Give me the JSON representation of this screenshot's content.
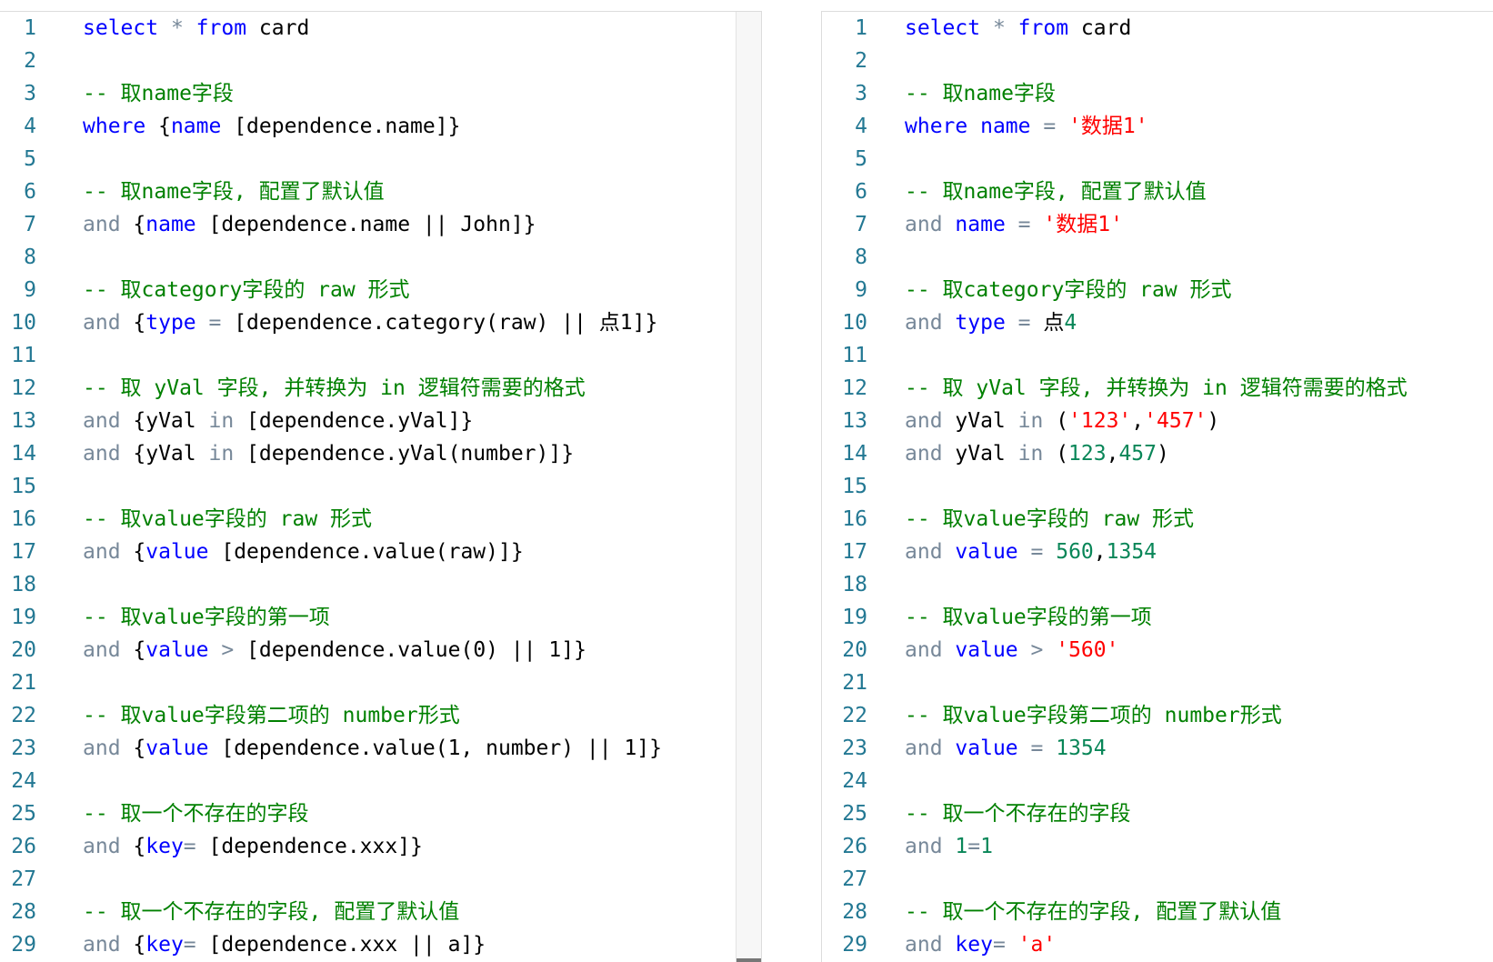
{
  "left_editor": {
    "lines": [
      {
        "no": "1",
        "tokens": [
          {
            "t": "kw",
            "v": "select"
          },
          {
            "t": "txt",
            "v": " "
          },
          {
            "t": "op",
            "v": "*"
          },
          {
            "t": "txt",
            "v": " "
          },
          {
            "t": "kw",
            "v": "from"
          },
          {
            "t": "txt",
            "v": " card"
          }
        ]
      },
      {
        "no": "2",
        "tokens": []
      },
      {
        "no": "3",
        "tokens": [
          {
            "t": "cmt",
            "v": "-- 取name字段"
          }
        ]
      },
      {
        "no": "4",
        "tokens": [
          {
            "t": "kw",
            "v": "where"
          },
          {
            "t": "txt",
            "v": " {"
          },
          {
            "t": "kw",
            "v": "name"
          },
          {
            "t": "txt",
            "v": " [dependence.name]}"
          }
        ]
      },
      {
        "no": "5",
        "tokens": []
      },
      {
        "no": "6",
        "tokens": [
          {
            "t": "cmt",
            "v": "-- 取name字段, 配置了默认值"
          }
        ]
      },
      {
        "no": "7",
        "tokens": [
          {
            "t": "op",
            "v": "and"
          },
          {
            "t": "txt",
            "v": " {"
          },
          {
            "t": "kw",
            "v": "name"
          },
          {
            "t": "txt",
            "v": " [dependence.name || John]}"
          }
        ]
      },
      {
        "no": "8",
        "tokens": []
      },
      {
        "no": "9",
        "tokens": [
          {
            "t": "cmt",
            "v": "-- 取category字段的 raw 形式"
          }
        ]
      },
      {
        "no": "10",
        "tokens": [
          {
            "t": "op",
            "v": "and"
          },
          {
            "t": "txt",
            "v": " {"
          },
          {
            "t": "kw",
            "v": "type"
          },
          {
            "t": "txt",
            "v": " "
          },
          {
            "t": "op",
            "v": "="
          },
          {
            "t": "txt",
            "v": " [dependence.category(raw) || 点1]}"
          }
        ]
      },
      {
        "no": "11",
        "tokens": []
      },
      {
        "no": "12",
        "tokens": [
          {
            "t": "cmt",
            "v": "-- 取 yVal 字段, 并转换为 in 逻辑符需要的格式"
          }
        ]
      },
      {
        "no": "13",
        "tokens": [
          {
            "t": "op",
            "v": "and"
          },
          {
            "t": "txt",
            "v": " {yVal "
          },
          {
            "t": "op",
            "v": "in"
          },
          {
            "t": "txt",
            "v": " [dependence.yVal]}"
          }
        ]
      },
      {
        "no": "14",
        "tokens": [
          {
            "t": "op",
            "v": "and"
          },
          {
            "t": "txt",
            "v": " {yVal "
          },
          {
            "t": "op",
            "v": "in"
          },
          {
            "t": "txt",
            "v": " [dependence.yVal(number)]}"
          }
        ]
      },
      {
        "no": "15",
        "tokens": []
      },
      {
        "no": "16",
        "tokens": [
          {
            "t": "cmt",
            "v": "-- 取value字段的 raw 形式"
          }
        ]
      },
      {
        "no": "17",
        "tokens": [
          {
            "t": "op",
            "v": "and"
          },
          {
            "t": "txt",
            "v": " {"
          },
          {
            "t": "kw",
            "v": "value"
          },
          {
            "t": "txt",
            "v": " [dependence.value(raw)]}"
          }
        ]
      },
      {
        "no": "18",
        "tokens": []
      },
      {
        "no": "19",
        "tokens": [
          {
            "t": "cmt",
            "v": "-- 取value字段的第一项"
          }
        ]
      },
      {
        "no": "20",
        "tokens": [
          {
            "t": "op",
            "v": "and"
          },
          {
            "t": "txt",
            "v": " {"
          },
          {
            "t": "kw",
            "v": "value"
          },
          {
            "t": "txt",
            "v": " "
          },
          {
            "t": "op",
            "v": ">"
          },
          {
            "t": "txt",
            "v": " [dependence.value(0) || 1]}"
          }
        ]
      },
      {
        "no": "21",
        "tokens": []
      },
      {
        "no": "22",
        "tokens": [
          {
            "t": "cmt",
            "v": "-- 取value字段第二项的 number形式"
          }
        ]
      },
      {
        "no": "23",
        "tokens": [
          {
            "t": "op",
            "v": "and"
          },
          {
            "t": "txt",
            "v": " {"
          },
          {
            "t": "kw",
            "v": "value"
          },
          {
            "t": "txt",
            "v": " [dependence.value(1, number) || 1]}"
          }
        ]
      },
      {
        "no": "24",
        "tokens": []
      },
      {
        "no": "25",
        "tokens": [
          {
            "t": "cmt",
            "v": "-- 取一个不存在的字段"
          }
        ]
      },
      {
        "no": "26",
        "tokens": [
          {
            "t": "op",
            "v": "and"
          },
          {
            "t": "txt",
            "v": " {"
          },
          {
            "t": "kw",
            "v": "key"
          },
          {
            "t": "op",
            "v": "="
          },
          {
            "t": "txt",
            "v": " [dependence.xxx]}"
          }
        ]
      },
      {
        "no": "27",
        "tokens": []
      },
      {
        "no": "28",
        "tokens": [
          {
            "t": "cmt",
            "v": "-- 取一个不存在的字段, 配置了默认值"
          }
        ]
      },
      {
        "no": "29",
        "tokens": [
          {
            "t": "op",
            "v": "and"
          },
          {
            "t": "txt",
            "v": " {"
          },
          {
            "t": "kw",
            "v": "key"
          },
          {
            "t": "op",
            "v": "="
          },
          {
            "t": "txt",
            "v": " [dependence.xxx || a]}"
          }
        ]
      }
    ]
  },
  "right_editor": {
    "lines": [
      {
        "no": "1",
        "tokens": [
          {
            "t": "kw",
            "v": "select"
          },
          {
            "t": "txt",
            "v": " "
          },
          {
            "t": "op",
            "v": "*"
          },
          {
            "t": "txt",
            "v": " "
          },
          {
            "t": "kw",
            "v": "from"
          },
          {
            "t": "txt",
            "v": " card"
          }
        ]
      },
      {
        "no": "2",
        "tokens": []
      },
      {
        "no": "3",
        "tokens": [
          {
            "t": "cmt",
            "v": "-- 取name字段"
          }
        ]
      },
      {
        "no": "4",
        "tokens": [
          {
            "t": "kw",
            "v": "where"
          },
          {
            "t": "txt",
            "v": " "
          },
          {
            "t": "kw",
            "v": "name"
          },
          {
            "t": "txt",
            "v": " "
          },
          {
            "t": "op",
            "v": "="
          },
          {
            "t": "txt",
            "v": " "
          },
          {
            "t": "str",
            "v": "'数据1'"
          }
        ]
      },
      {
        "no": "5",
        "tokens": []
      },
      {
        "no": "6",
        "tokens": [
          {
            "t": "cmt",
            "v": "-- 取name字段, 配置了默认值"
          }
        ]
      },
      {
        "no": "7",
        "tokens": [
          {
            "t": "op",
            "v": "and"
          },
          {
            "t": "txt",
            "v": " "
          },
          {
            "t": "kw",
            "v": "name"
          },
          {
            "t": "txt",
            "v": " "
          },
          {
            "t": "op",
            "v": "="
          },
          {
            "t": "txt",
            "v": " "
          },
          {
            "t": "str",
            "v": "'数据1'"
          }
        ]
      },
      {
        "no": "8",
        "tokens": []
      },
      {
        "no": "9",
        "tokens": [
          {
            "t": "cmt",
            "v": "-- 取category字段的 raw 形式"
          }
        ]
      },
      {
        "no": "10",
        "tokens": [
          {
            "t": "op",
            "v": "and"
          },
          {
            "t": "txt",
            "v": " "
          },
          {
            "t": "kw",
            "v": "type"
          },
          {
            "t": "txt",
            "v": " "
          },
          {
            "t": "op",
            "v": "="
          },
          {
            "t": "txt",
            "v": " 点"
          },
          {
            "t": "num",
            "v": "4"
          }
        ]
      },
      {
        "no": "11",
        "tokens": []
      },
      {
        "no": "12",
        "tokens": [
          {
            "t": "cmt",
            "v": "-- 取 yVal 字段, 并转换为 in 逻辑符需要的格式"
          }
        ]
      },
      {
        "no": "13",
        "tokens": [
          {
            "t": "op",
            "v": "and"
          },
          {
            "t": "txt",
            "v": " yVal "
          },
          {
            "t": "op",
            "v": "in"
          },
          {
            "t": "txt",
            "v": " ("
          },
          {
            "t": "str",
            "v": "'123'"
          },
          {
            "t": "txt",
            "v": ","
          },
          {
            "t": "str",
            "v": "'457'"
          },
          {
            "t": "txt",
            "v": ")"
          }
        ]
      },
      {
        "no": "14",
        "tokens": [
          {
            "t": "op",
            "v": "and"
          },
          {
            "t": "txt",
            "v": " yVal "
          },
          {
            "t": "op",
            "v": "in"
          },
          {
            "t": "txt",
            "v": " ("
          },
          {
            "t": "num",
            "v": "123"
          },
          {
            "t": "txt",
            "v": ","
          },
          {
            "t": "num",
            "v": "457"
          },
          {
            "t": "txt",
            "v": ")"
          }
        ]
      },
      {
        "no": "15",
        "tokens": []
      },
      {
        "no": "16",
        "tokens": [
          {
            "t": "cmt",
            "v": "-- 取value字段的 raw 形式"
          }
        ]
      },
      {
        "no": "17",
        "tokens": [
          {
            "t": "op",
            "v": "and"
          },
          {
            "t": "txt",
            "v": " "
          },
          {
            "t": "kw",
            "v": "value"
          },
          {
            "t": "txt",
            "v": " "
          },
          {
            "t": "op",
            "v": "="
          },
          {
            "t": "txt",
            "v": " "
          },
          {
            "t": "num",
            "v": "560"
          },
          {
            "t": "txt",
            "v": ","
          },
          {
            "t": "num",
            "v": "1354"
          }
        ]
      },
      {
        "no": "18",
        "tokens": []
      },
      {
        "no": "19",
        "tokens": [
          {
            "t": "cmt",
            "v": "-- 取value字段的第一项"
          }
        ]
      },
      {
        "no": "20",
        "tokens": [
          {
            "t": "op",
            "v": "and"
          },
          {
            "t": "txt",
            "v": " "
          },
          {
            "t": "kw",
            "v": "value"
          },
          {
            "t": "txt",
            "v": " "
          },
          {
            "t": "op",
            "v": ">"
          },
          {
            "t": "txt",
            "v": " "
          },
          {
            "t": "str",
            "v": "'560'"
          }
        ]
      },
      {
        "no": "21",
        "tokens": []
      },
      {
        "no": "22",
        "tokens": [
          {
            "t": "cmt",
            "v": "-- 取value字段第二项的 number形式"
          }
        ]
      },
      {
        "no": "23",
        "tokens": [
          {
            "t": "op",
            "v": "and"
          },
          {
            "t": "txt",
            "v": " "
          },
          {
            "t": "kw",
            "v": "value"
          },
          {
            "t": "txt",
            "v": " "
          },
          {
            "t": "op",
            "v": "="
          },
          {
            "t": "txt",
            "v": " "
          },
          {
            "t": "num",
            "v": "1354"
          }
        ]
      },
      {
        "no": "24",
        "tokens": []
      },
      {
        "no": "25",
        "tokens": [
          {
            "t": "cmt",
            "v": "-- 取一个不存在的字段"
          }
        ]
      },
      {
        "no": "26",
        "tokens": [
          {
            "t": "op",
            "v": "and"
          },
          {
            "t": "txt",
            "v": " "
          },
          {
            "t": "num",
            "v": "1"
          },
          {
            "t": "op",
            "v": "="
          },
          {
            "t": "num",
            "v": "1"
          }
        ]
      },
      {
        "no": "27",
        "tokens": []
      },
      {
        "no": "28",
        "tokens": [
          {
            "t": "cmt",
            "v": "-- 取一个不存在的字段, 配置了默认值"
          }
        ]
      },
      {
        "no": "29",
        "tokens": [
          {
            "t": "op",
            "v": "and"
          },
          {
            "t": "txt",
            "v": " "
          },
          {
            "t": "kw",
            "v": "key"
          },
          {
            "t": "op",
            "v": "="
          },
          {
            "t": "txt",
            "v": " "
          },
          {
            "t": "str",
            "v": "'a'"
          }
        ]
      }
    ]
  }
}
